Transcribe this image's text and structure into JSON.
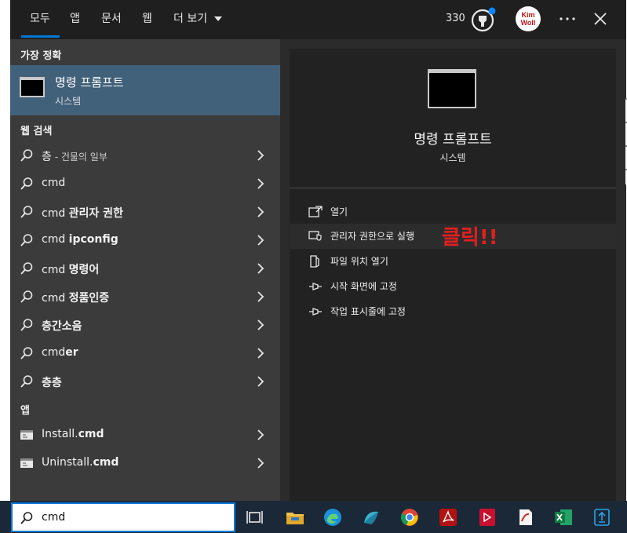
{
  "tabs": {
    "all": "모두",
    "apps": "앱",
    "documents": "문서",
    "web": "웹",
    "more": "더 보기"
  },
  "header": {
    "points": "330",
    "avatar_text": "Kim Woll"
  },
  "sections": {
    "best_match": "가장 정확",
    "web_search": "웹 검색",
    "apps": "앱"
  },
  "best_match": {
    "title": "명령 프롬프트",
    "subtitle": "시스템"
  },
  "web_results": [
    {
      "main": "층",
      "sub": " - 건물의 일부"
    },
    {
      "main": "cmd",
      "bold": ""
    },
    {
      "main": "cmd ",
      "bold": "관리자 권한"
    },
    {
      "main": "cmd ",
      "bold": "ipconfig"
    },
    {
      "main": "cmd ",
      "bold": "명령어"
    },
    {
      "main": "cmd ",
      "bold": "정품인증"
    },
    {
      "main": "",
      "bold": "층간소음"
    },
    {
      "main": "cmd",
      "bold": "er"
    },
    {
      "main": "",
      "bold": "층층"
    }
  ],
  "app_results": [
    {
      "main": "Install.",
      "bold": "cmd"
    },
    {
      "main": "Uninstall.",
      "bold": "cmd"
    }
  ],
  "detail": {
    "title": "명령 프롬프트",
    "subtitle": "시스템"
  },
  "actions": [
    {
      "label": "열기",
      "icon": "open-icon"
    },
    {
      "label": "관리자 권한으로 실행",
      "icon": "shield-icon"
    },
    {
      "label": "파일 위치 열기",
      "icon": "file-location-icon"
    },
    {
      "label": "시작 화면에 고정",
      "icon": "pin-icon"
    },
    {
      "label": "작업 표시줄에 고정",
      "icon": "pin-icon"
    }
  ],
  "annotation": "클릭!!",
  "search": {
    "value": "cmd"
  },
  "colors": {
    "accent": "#0078d4",
    "annotation": "#e02020",
    "selected": "#41607a"
  }
}
